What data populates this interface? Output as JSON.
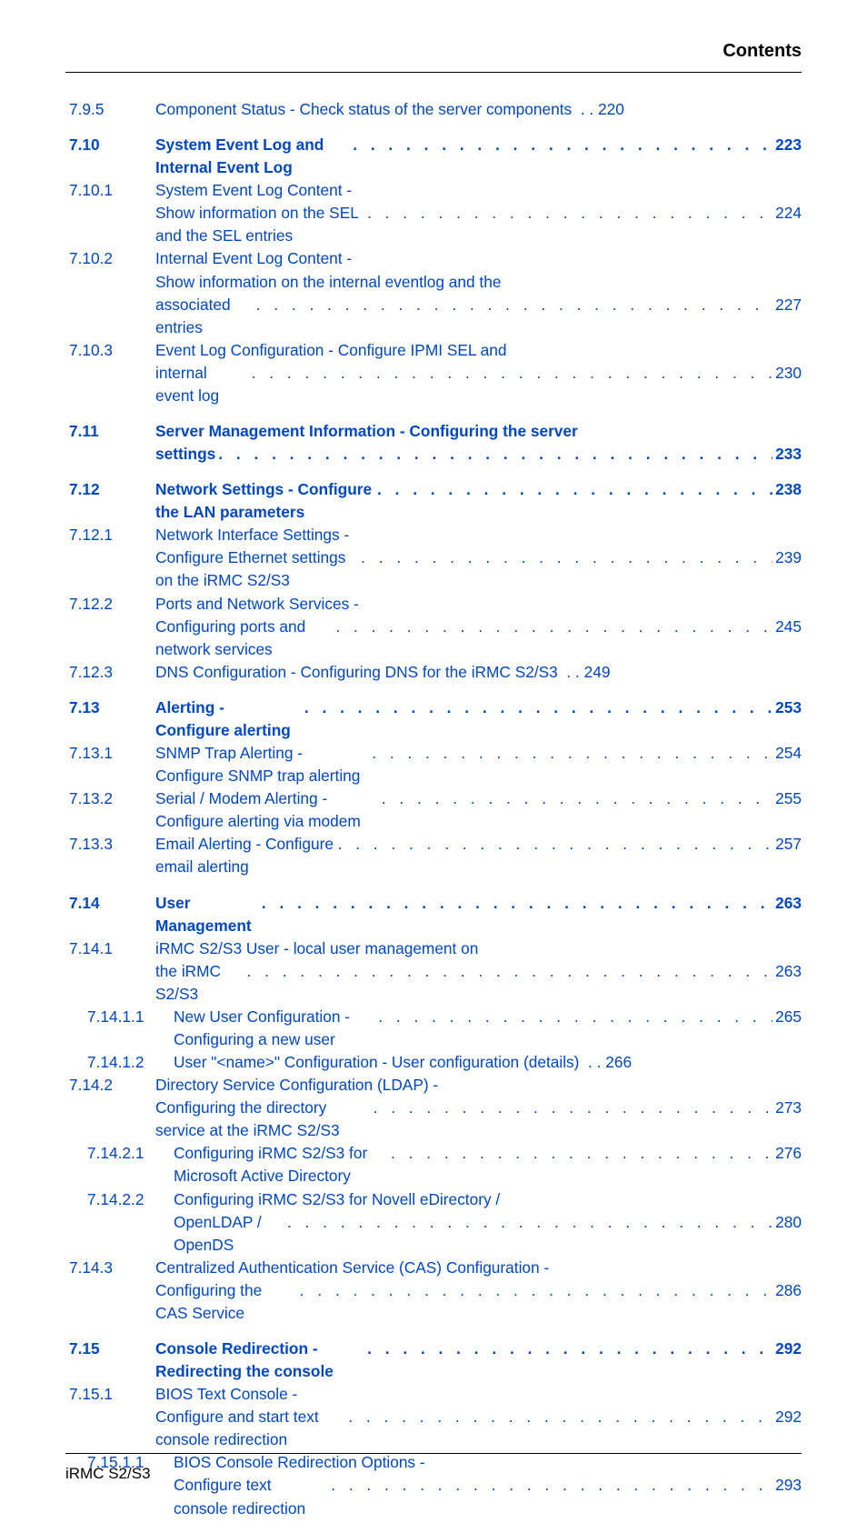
{
  "header_title": "Contents",
  "footer": "iRMC S2/S3",
  "leader": ".  .  .  .  .  .  .  .  .  .  .  .  .  .  .  .  .  .  .  .  .  .  .  .  .  .  .  .  .  .  .  .  .  .  .  .  .  .",
  "blocks": [
    {
      "entries": [
        {
          "num": "7.9.5",
          "title_lines": [
            "Component Status - Check status of the server components"
          ],
          "page": "220",
          "leader_on_last": false
        }
      ]
    },
    {
      "entries": [
        {
          "num": "7.10",
          "bold": true,
          "title_lines": [
            "System Event Log and Internal Event Log"
          ],
          "page": "223",
          "leader_on_last": true
        },
        {
          "num": "7.10.1",
          "title_lines": [
            "System Event Log Content -",
            "Show information on the SEL and the SEL entries"
          ],
          "page": "224",
          "leader_on_last": true
        },
        {
          "num": "7.10.2",
          "title_lines": [
            "Internal Event Log Content -",
            "Show information on the internal eventlog and the",
            "associated entries"
          ],
          "page": "227",
          "leader_on_last": true
        },
        {
          "num": "7.10.3",
          "title_lines": [
            "Event Log Configuration - Configure IPMI SEL and",
            "internal event log"
          ],
          "page": "230",
          "leader_on_last": true
        }
      ]
    },
    {
      "entries": [
        {
          "num": "7.11",
          "bold": true,
          "title_lines": [
            "Server Management Information - Configuring the server",
            "settings"
          ],
          "page": "233",
          "leader_on_last": true
        }
      ]
    },
    {
      "entries": [
        {
          "num": "7.12",
          "bold": true,
          "title_lines": [
            "Network Settings - Configure the LAN parameters"
          ],
          "page": "238",
          "leader_on_last": true
        },
        {
          "num": "7.12.1",
          "title_lines": [
            "Network Interface Settings -",
            "Configure Ethernet settings on the iRMC S2/S3"
          ],
          "page": "239",
          "leader_on_last": true
        },
        {
          "num": "7.12.2",
          "title_lines": [
            "Ports and Network Services -",
            "Configuring ports and network services"
          ],
          "page": "245",
          "leader_on_last": true
        },
        {
          "num": "7.12.3",
          "title_lines": [
            "DNS Configuration - Configuring DNS for the iRMC S2/S3"
          ],
          "page": "249",
          "leader_on_last": false
        }
      ]
    },
    {
      "entries": [
        {
          "num": "7.13",
          "bold": true,
          "title_lines": [
            "Alerting - Configure alerting"
          ],
          "page": "253",
          "leader_on_last": true
        },
        {
          "num": "7.13.1",
          "title_lines": [
            "SNMP Trap Alerting - Configure SNMP trap alerting"
          ],
          "page": "254",
          "leader_on_last": true
        },
        {
          "num": "7.13.2",
          "title_lines": [
            "Serial / Modem Alerting - Configure alerting via modem"
          ],
          "page": "255",
          "leader_on_last": true
        },
        {
          "num": "7.13.3",
          "title_lines": [
            "Email Alerting - Configure email alerting"
          ],
          "page": "257",
          "leader_on_last": true
        }
      ]
    },
    {
      "entries": [
        {
          "num": "7.14",
          "bold": true,
          "title_lines": [
            "User Management"
          ],
          "page": "263",
          "leader_on_last": true
        },
        {
          "num": "7.14.1",
          "title_lines": [
            "iRMC S2/S3 User - local user management on",
            "the iRMC S2/S3"
          ],
          "page": "263",
          "leader_on_last": true
        },
        {
          "num": "7.14.1.1",
          "indent": 1,
          "title_lines": [
            "New User Configuration - Configuring a new user"
          ],
          "page": "265",
          "leader_on_last": true
        },
        {
          "num": "7.14.1.2",
          "indent": 1,
          "title_lines": [
            "User \"<name>\" Configuration - User configuration (details)"
          ],
          "page": "266",
          "leader_on_last": false
        },
        {
          "num": "7.14.2",
          "title_lines": [
            "Directory Service Configuration (LDAP) -",
            "Configuring the directory service at the iRMC S2/S3"
          ],
          "page": "273",
          "leader_on_last": true
        },
        {
          "num": "7.14.2.1",
          "indent": 1,
          "title_lines": [
            "Configuring iRMC S2/S3 for Microsoft Active Directory"
          ],
          "page": "276",
          "leader_on_last": true
        },
        {
          "num": "7.14.2.2",
          "indent": 1,
          "title_lines": [
            "Configuring iRMC S2/S3 for Novell eDirectory /",
            "OpenLDAP / OpenDS"
          ],
          "page": "280",
          "leader_on_last": true
        },
        {
          "num": "7.14.3",
          "title_lines": [
            "Centralized Authentication Service (CAS) Configuration -",
            "Configuring the CAS Service"
          ],
          "page": "286",
          "leader_on_last": true
        }
      ]
    },
    {
      "entries": [
        {
          "num": "7.15",
          "bold": true,
          "title_lines": [
            "Console Redirection - Redirecting the console"
          ],
          "page": "292",
          "leader_on_last": true
        },
        {
          "num": "7.15.1",
          "title_lines": [
            "BIOS Text Console -",
            "Configure and start text console redirection"
          ],
          "page": "292",
          "leader_on_last": true
        },
        {
          "num": "7.15.1.1",
          "indent": 1,
          "title_lines": [
            "BIOS Console Redirection Options -",
            "Configure text console redirection"
          ],
          "page": "293",
          "leader_on_last": true
        }
      ]
    }
  ]
}
